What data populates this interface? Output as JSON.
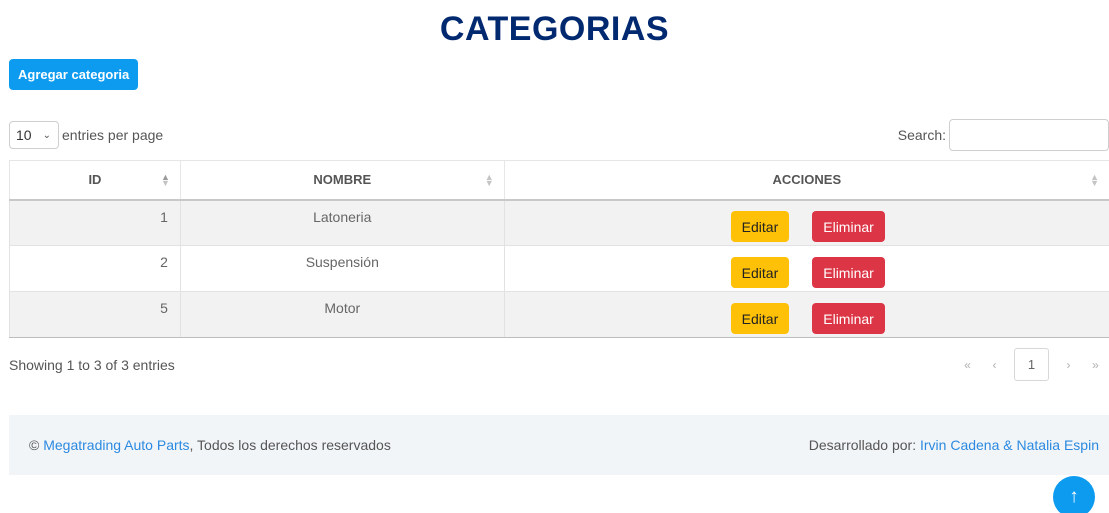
{
  "page": {
    "title": "CATEGORIAS"
  },
  "toolbar": {
    "add_label": "Agregar categoria"
  },
  "length_menu": {
    "value": "10",
    "suffix": "entries per page",
    "options": [
      "10"
    ]
  },
  "search": {
    "label": "Search:",
    "value": "",
    "placeholder": ""
  },
  "table": {
    "headers": {
      "id": "ID",
      "name": "NOMBRE",
      "actions": "ACCIONES"
    },
    "rows": [
      {
        "id": "1",
        "name": "Latoneria",
        "edit": "Editar",
        "delete": "Eliminar"
      },
      {
        "id": "2",
        "name": "Suspensión",
        "edit": "Editar",
        "delete": "Eliminar"
      },
      {
        "id": "5",
        "name": "Motor",
        "edit": "Editar",
        "delete": "Eliminar"
      }
    ]
  },
  "info": "Showing 1 to 3 of 3 entries",
  "pagination": {
    "first": "«",
    "prev": "‹",
    "current": "1",
    "next": "›",
    "last": "»"
  },
  "footer": {
    "copyright_symbol": "©",
    "company": "Megatrading Auto Parts",
    "rights": ", Todos los derechos reservados",
    "dev_label": "Desarrollado por: ",
    "devs": "Irvin Cadena & Natalia Espin"
  },
  "back_to_top": {
    "icon": "arrow-up-icon",
    "glyph": "↑"
  },
  "colors": {
    "title": "#012970",
    "primary": "#0d9bf0",
    "edit": "#ffc107",
    "delete": "#dc3545",
    "link": "#2b8ae0",
    "footer_bg": "#f2f5f8"
  }
}
